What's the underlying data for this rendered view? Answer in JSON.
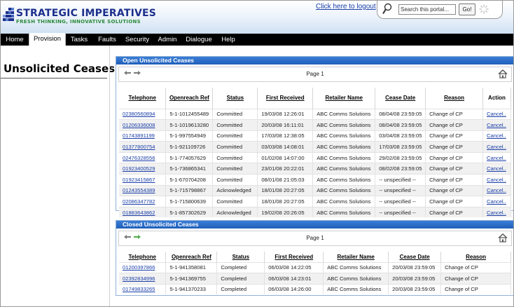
{
  "brand": {
    "title": "STRATEGIC IMPERATIVES",
    "tagline": "FRESH THINKING, INNOVATIVE SOLUTIONS"
  },
  "header": {
    "logout_link": "Click here to logout",
    "search": {
      "value": "Search this portal...",
      "go_label": "Go!"
    }
  },
  "nav": {
    "items": [
      "Home",
      "Provision",
      "Tasks",
      "Faults",
      "Security",
      "Admin",
      "Dialogue",
      "Help"
    ],
    "active": "Provision"
  },
  "page": {
    "title": "Unsolicited Ceases"
  },
  "open_panel": {
    "title": "Open Unsolicited Ceases",
    "page_label": "Page 1",
    "columns": [
      "Telephone",
      "Openreach Ref",
      "Status",
      "First Received",
      "Retailer Name",
      "Cease Date",
      "Reason",
      "Action"
    ],
    "rows": [
      [
        "02380560894",
        "5-1-1012455489",
        "Committed",
        "19/03/08 12:26:01",
        "ABC Comms Solutions",
        "08/04/08 23:59:05",
        "Change of CP",
        "Cancel.."
      ],
      [
        "01206336008",
        "5-1-1019613280",
        "Committed",
        "20/03/08 16:11:01",
        "ABC Comms Solutions",
        "08/04/08 23:59:05",
        "Change of CP",
        "Cancel.."
      ],
      [
        "01743891199",
        "5-1-997554949",
        "Committed",
        "17/03/08 12:38:05",
        "ABC Comms Solutions",
        "03/04/08 23:59:05",
        "Change of CP",
        "Cancel.."
      ],
      [
        "01377800754",
        "5-1-921109726",
        "Committed",
        "03/03/08 14:08:01",
        "ABC Comms Solutions",
        "17/03/08 23:59:05",
        "Change of CP",
        "Cancel.."
      ],
      [
        "02476328556",
        "5-1-774057629",
        "Committed",
        "01/02/08 14:07:00",
        "ABC Comms Solutions",
        "29/02/08 23:59:05",
        "Change of CP",
        "Cancel.."
      ],
      [
        "01923400529",
        "5-1-736865341",
        "Committed",
        "23/01/08 20:22:01",
        "ABC Comms Solutions",
        "08/02/08 23:59:05",
        "Change of CP",
        "Cancel.."
      ],
      [
        "01923415867",
        "5-1-670704208",
        "Committed",
        "08/01/08 21:05:03",
        "ABC Comms Solutions",
        "-- unspecified --",
        "Change of CP",
        "Cancel.."
      ],
      [
        "01243554389",
        "5-1-715798867",
        "Acknowledged",
        "18/01/08 20:27:05",
        "ABC Comms Solutions",
        "-- unspecified --",
        "Change of CP",
        "Cancel.."
      ],
      [
        "02086347782",
        "5-1-715800639",
        "Committed",
        "18/01/08 20:27:05",
        "ABC Comms Solutions",
        "-- unspecified --",
        "Change of CP",
        "Cancel.."
      ],
      [
        "01883643862",
        "5-1-857302629",
        "Acknowledged",
        "19/02/08 20:26:05",
        "ABC Comms Solutions",
        "-- unspecified --",
        "Change of CP",
        "Cancel.."
      ]
    ]
  },
  "closed_panel": {
    "title": "Closed Unsolicited Ceases",
    "page_label": "Page 1",
    "columns": [
      "Telephone",
      "Openreach Ref",
      "Status",
      "First Received",
      "Retailer Name",
      "Cease Date",
      "Reason"
    ],
    "rows": [
      [
        "01200397866",
        "5-1-941358081",
        "Completed",
        "06/03/08 14:22:05",
        "ABC Comms Solutions",
        "20/03/08 23:59:05",
        "Change of CP"
      ],
      [
        "02392834996",
        "5-1-941369755",
        "Completed",
        "06/03/08 14:23:01",
        "ABC Comms Solutions",
        "20/03/08 23:59:05",
        "Change of CP"
      ],
      [
        "01749833265",
        "5-1-941370233",
        "Completed",
        "06/03/08 14:26:00",
        "ABC Comms Solutions",
        "20/03/08 23:59:05",
        "Change of CP"
      ]
    ]
  },
  "colors": {
    "brand_blue": "#1c2f8c",
    "brand_green": "#2a8a3a",
    "panel_title": "#2a6cc9",
    "link": "#1a3ea8"
  }
}
